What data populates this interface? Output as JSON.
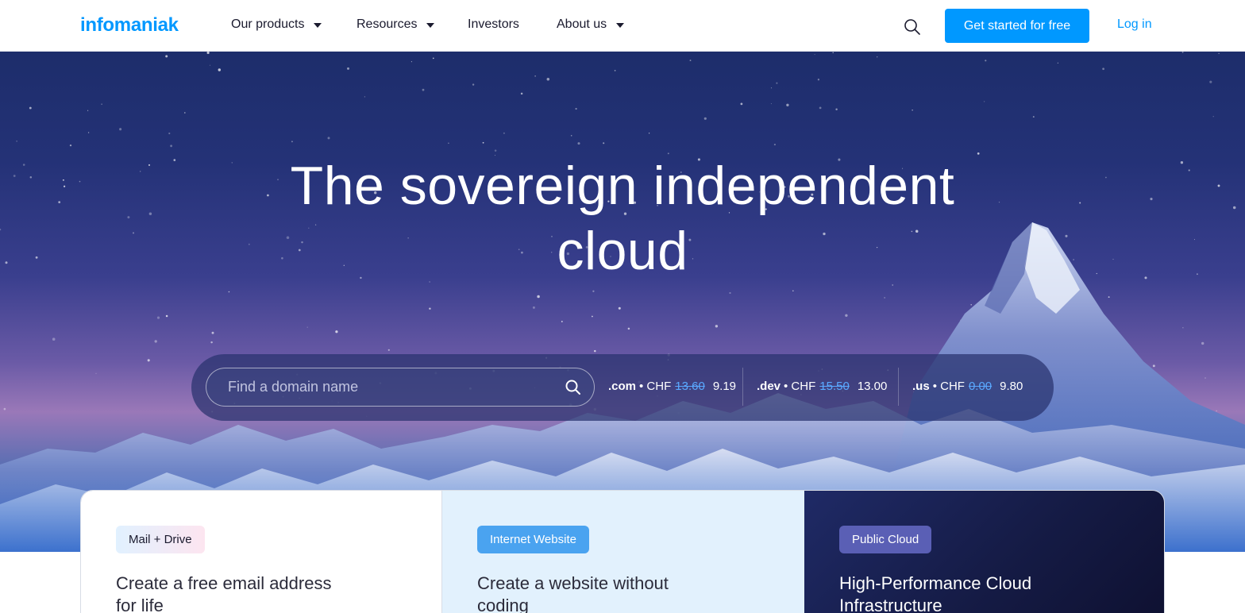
{
  "header": {
    "logo": "infomaniak",
    "nav": [
      {
        "label": "Our products",
        "has_dropdown": true
      },
      {
        "label": "Resources",
        "has_dropdown": true
      },
      {
        "label": "Investors",
        "has_dropdown": false
      },
      {
        "label": "About us",
        "has_dropdown": true
      }
    ],
    "search_icon": "search-icon",
    "cta_label": "Get started for free",
    "login_label": "Log in"
  },
  "hero": {
    "title_line1": "The sovereign independent",
    "title_line2": "cloud"
  },
  "domain_search": {
    "placeholder": "Find a domain name",
    "search_icon": "search-icon",
    "prices": [
      {
        "ext": ".com",
        "currency": "• CHF",
        "old": "13.60",
        "new": "9.19"
      },
      {
        "ext": ".dev",
        "currency": "• CHF",
        "old": "15.50",
        "new": "13.00"
      },
      {
        "ext": ".us",
        "currency": "• CHF",
        "old": "0.00",
        "new": "9.80"
      }
    ]
  },
  "cards": [
    {
      "badge": "Mail + Drive",
      "title": "Create a free email address for life"
    },
    {
      "badge": "Internet Website",
      "title": "Create a website without coding"
    },
    {
      "badge": "Public Cloud",
      "title": "High-Performance Cloud Infrastructure"
    }
  ],
  "colors": {
    "brand": "#0098ff",
    "strike_price": "#5aa9ff",
    "hero_top": "#1d2d6b",
    "card3_bg": "#151b45"
  }
}
